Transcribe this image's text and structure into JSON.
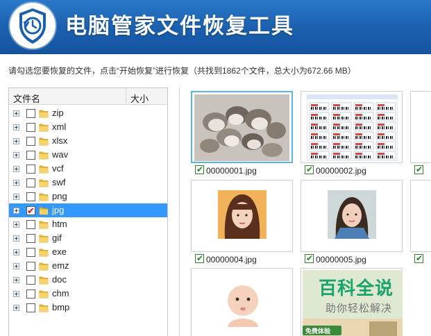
{
  "header": {
    "title": "电脑管家文件恢复工具"
  },
  "info_line": "请勾选您要恢复的文件，点击“开始恢复”进行恢复（共找到1862个文件，总大小为672.66 MB）",
  "tree": {
    "columns": {
      "name": "文件名",
      "size": "大小"
    },
    "items": [
      {
        "label": "zip",
        "checked": false,
        "selected": false
      },
      {
        "label": "xml",
        "checked": false,
        "selected": false
      },
      {
        "label": "xlsx",
        "checked": false,
        "selected": false
      },
      {
        "label": "wav",
        "checked": false,
        "selected": false
      },
      {
        "label": "vcf",
        "checked": false,
        "selected": false
      },
      {
        "label": "swf",
        "checked": false,
        "selected": false
      },
      {
        "label": "png",
        "checked": false,
        "selected": false
      },
      {
        "label": "jpg",
        "checked": true,
        "selected": true
      },
      {
        "label": "htm",
        "checked": false,
        "selected": false
      },
      {
        "label": "gif",
        "checked": false,
        "selected": false
      },
      {
        "label": "exe",
        "checked": false,
        "selected": false
      },
      {
        "label": "emz",
        "checked": false,
        "selected": false
      },
      {
        "label": "doc",
        "checked": false,
        "selected": false
      },
      {
        "label": "chm",
        "checked": false,
        "selected": false
      },
      {
        "label": "bmp",
        "checked": false,
        "selected": false
      }
    ]
  },
  "thumbnails": [
    {
      "name": "00000001.jpg",
      "checked": true,
      "focused": true,
      "image": "mushrooms-photo"
    },
    {
      "name": "00000002.jpg",
      "checked": true,
      "focused": false,
      "image": "spreadsheet-document"
    },
    {
      "name": "",
      "checked": true,
      "focused": false,
      "image": "partial"
    },
    {
      "name": "00000004.jpg",
      "checked": true,
      "focused": false,
      "image": "woman-portrait"
    },
    {
      "name": "00000005.jpg",
      "checked": true,
      "focused": false,
      "image": "girl-portrait"
    },
    {
      "name": "",
      "checked": true,
      "focused": false,
      "image": "partial"
    },
    {
      "name": "",
      "checked": false,
      "focused": false,
      "image": "baby-photo"
    },
    {
      "name": "",
      "checked": false,
      "focused": false,
      "image": "ad-banner"
    }
  ],
  "ad_banner": {
    "button": "免费体验"
  },
  "watermark": {
    "title": "百科全说",
    "subtitle": "助你轻松解决"
  },
  "colors": {
    "header_bg": "#1a5fae",
    "selected_row": "#3399ff",
    "thumb_focus": "#5bb3e0",
    "check_green": "#1c8a1c",
    "check_red": "#cc1111",
    "watermark_green": "#1aa36a"
  }
}
